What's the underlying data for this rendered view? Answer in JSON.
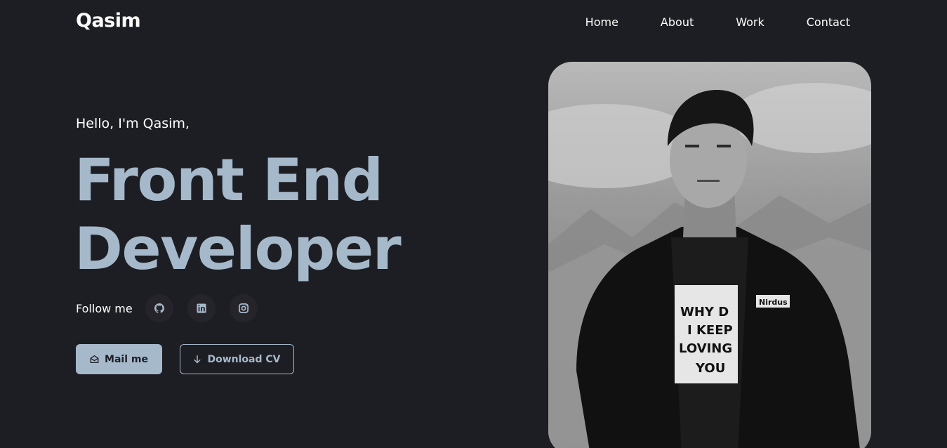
{
  "brand": "Qasim",
  "nav": [
    "Home",
    "About",
    "Work",
    "Contact"
  ],
  "hero": {
    "greeting": "Hello, I'm Qasim,",
    "title_line1": "Front End",
    "title_line2": "Developer",
    "follow_label": "Follow me",
    "socials": [
      "github-icon",
      "linkedin-icon",
      "instagram-icon"
    ],
    "mail_button": "Mail me",
    "cv_button": "Download CV",
    "shirt_text": [
      "WHY D",
      "I KEEP",
      "LOVING",
      "YOU"
    ],
    "jacket_badge": "Nirdus"
  },
  "colors": {
    "background": "#1d1e23",
    "accent": "#a6b9cb",
    "social_bg": "#25242a"
  }
}
